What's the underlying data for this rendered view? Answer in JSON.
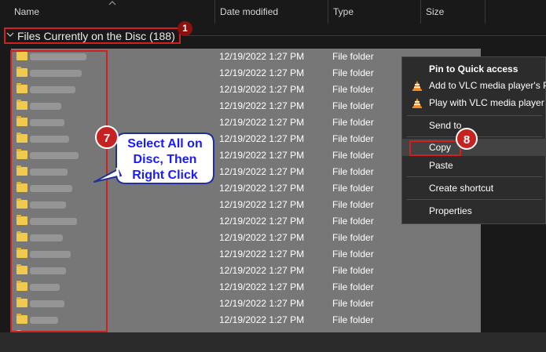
{
  "header": {
    "columns": [
      {
        "label": "Name"
      },
      {
        "label": "Date modified"
      },
      {
        "label": "Type"
      },
      {
        "label": "Size"
      }
    ]
  },
  "group": {
    "title": "Files Currently on the Disc (188)",
    "badge": "1"
  },
  "rows": [
    {
      "date": "12/19/2022 1:27 PM",
      "type": "File folder"
    },
    {
      "date": "12/19/2022 1:27 PM",
      "type": "File folder"
    },
    {
      "date": "12/19/2022 1:27 PM",
      "type": "File folder"
    },
    {
      "date": "12/19/2022 1:27 PM",
      "type": "File folder"
    },
    {
      "date": "12/19/2022 1:27 PM",
      "type": "File folder"
    },
    {
      "date": "12/19/2022 1:27 PM",
      "type": "File folder"
    },
    {
      "date": "12/19/2022 1:27 PM",
      "type": "File folder"
    },
    {
      "date": "12/19/2022 1:27 PM",
      "type": "File folder"
    },
    {
      "date": "12/19/2022 1:27 PM",
      "type": "File folder"
    },
    {
      "date": "12/19/2022 1:27 PM",
      "type": "File folder"
    },
    {
      "date": "12/19/2022 1:27 PM",
      "type": "File folder"
    },
    {
      "date": "12/19/2022 1:27 PM",
      "type": "File folder"
    },
    {
      "date": "12/19/2022 1:27 PM",
      "type": "File folder"
    },
    {
      "date": "12/19/2022 1:27 PM",
      "type": "File folder"
    },
    {
      "date": "12/19/2022 1:27 PM",
      "type": "File folder"
    },
    {
      "date": "12/19/2022 1:27 PM",
      "type": "File folder"
    },
    {
      "date": "12/19/2022 1:27 PM",
      "type": "File folder"
    },
    {
      "date": "12/19/2022 1:27 PM",
      "type": "File folder"
    }
  ],
  "callout": {
    "badge": "7",
    "line1": "Select All on",
    "line2": "Disc, Then",
    "line3": "Right Click"
  },
  "context_menu": {
    "items": [
      {
        "label": "Pin to Quick access",
        "icon": "none"
      },
      {
        "label": "Add to VLC media player's Playlist",
        "icon": "vlc-cone-icon"
      },
      {
        "label": "Play with VLC media player",
        "icon": "vlc-cone-icon"
      },
      {
        "label": "Send to",
        "icon": "none"
      },
      {
        "label": "Copy",
        "icon": "none"
      },
      {
        "label": "Paste",
        "icon": "none"
      },
      {
        "label": "Create shortcut",
        "icon": "none"
      },
      {
        "label": "Properties",
        "icon": "none"
      }
    ],
    "copy_badge": "8"
  },
  "colors": {
    "selection": "#777777",
    "annotation_red": "#d21f1f",
    "callout_text": "#1a1aff",
    "folder": "#f0c94f"
  }
}
